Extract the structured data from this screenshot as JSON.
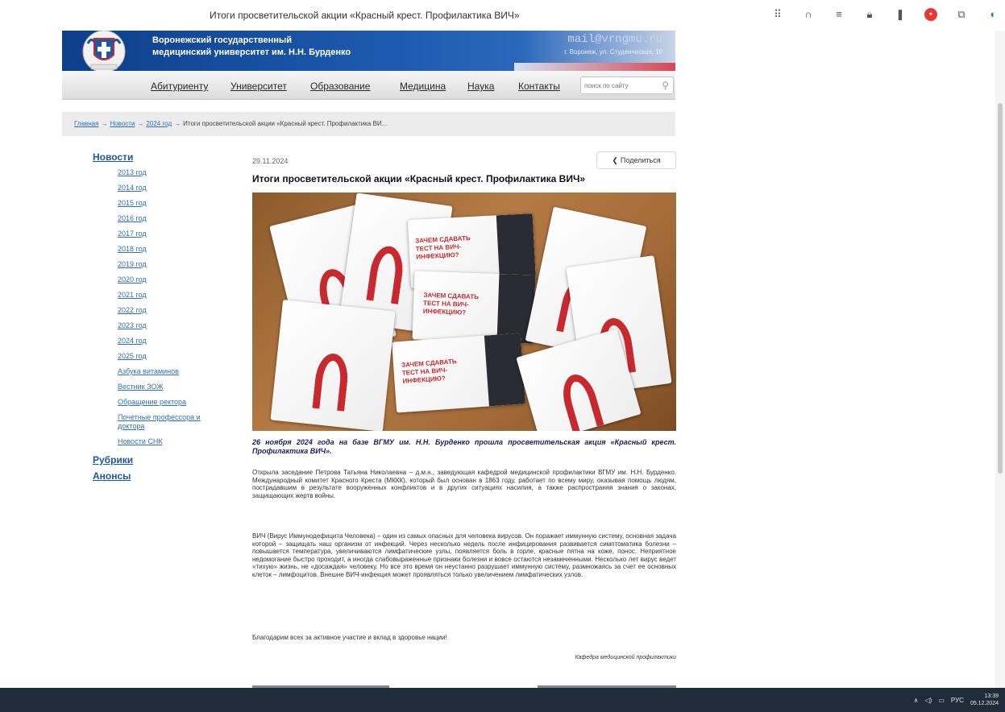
{
  "browser": {
    "title": "Итоги просветительской акции «Красный крест. Профилактика ВИЧ»",
    "icons": [
      "grid-icon",
      "headphones-icon",
      "reader-icon",
      "lock-icon",
      "bookmark-icon",
      "extension-icon",
      "tab-icon",
      "profile-icon"
    ]
  },
  "header": {
    "uni_line1": "Воронежский государственный",
    "uni_line2": "медицинский университет им. Н.Н. Бурденко",
    "email": "mail@vrngmu.ru",
    "address": "г. Воронеж, ул. Студенческая, 10",
    "brand_color": "#1e5bb0"
  },
  "nav": {
    "items": [
      "Абитуриенту",
      "Университет",
      "Образование",
      "Медицина",
      "Наука",
      "Контакты"
    ],
    "search_placeholder": "поиск по сайту"
  },
  "breadcrumb": {
    "items": [
      "Главная",
      "Новости",
      "2024 год"
    ],
    "current": "Итоги просветительской акции «Красный крест. Профилактика ВИ..."
  },
  "sidebar": {
    "news_label": "Новости",
    "years": [
      "2013 год",
      "2014 год",
      "2015 год",
      "2016 год",
      "2017 год",
      "2018 год",
      "2019 год",
      "2020 год",
      "2021 год",
      "2022 год",
      "2023 год",
      "2024 год",
      "2025 год"
    ],
    "sub_items": [
      "Азбука витаминов",
      "Вестник ЗОЖ",
      "Обращение ректора",
      "Почетные профессора и доктора",
      "Новости СНК"
    ],
    "rubrics_label": "Рубрики",
    "announces_label": "Анонсы"
  },
  "article": {
    "date": "29.11.2024",
    "share_label": "Поделиться",
    "title": "Итоги просветительской акции «Красный крест. Профилактика ВИЧ»",
    "card_text": "ЗАЧЕМ СДАВАТЬ ТЕСТ НА ВИЧ-ИНФЕКЦИЮ?",
    "lead": "26 ноября 2024 года на базе ВГМУ им. Н.Н. Бурденко прошла просветительская акция «Красный крест. Профилактика ВИЧ».",
    "p1": "Открыла заседание Петрова Татьяна Николаевна – д.м.н., заведующая кафедрой медицинской профилактики ВГМУ им. Н.Н. Бурденко. Международный комитет Красного Креста (МККК), который был основан в 1863 году, работает по всему миру, оказывая помощь людям, пострадавшим в результате вооруженных конфликтов и в других ситуациях насилия, а также распространяя знания о законах, защищающих жертв войны.",
    "p2": "ВИЧ (Вирус Иммунодефицита Человека) – один из самых опасных для человека вирусов. Он поражает иммунную систему, основная задача которой – защищать наш организм от инфекций. Через несколько недель после инфицирования развивается симптоматика болезни – повышается температура, увеличиваются лимфатические узлы, появляется боль в горле, красные пятна на коже, понос. Неприятное недомогание быстро проходит, а иногда слабовыраженные признаки болезни и вовсе остаются незамеченными. Несколько лет вирус ведет «тихую» жизнь, не «досаждая» человеку. Но все это время он неустанно разрушает иммунную систему, размножаясь за счет ее основных клеток – лимфоцитов. Внешне ВИЧ-инфекция может проявляться только увеличением лимфатических узлов.",
    "p3": "Благодарим всех за активное участие и вклад в здоровье нации!",
    "signature": "Кафедра медицинской профилактики"
  },
  "taskbar": {
    "lang": "РУС",
    "time": "13:39",
    "date": "05.12.2024"
  }
}
